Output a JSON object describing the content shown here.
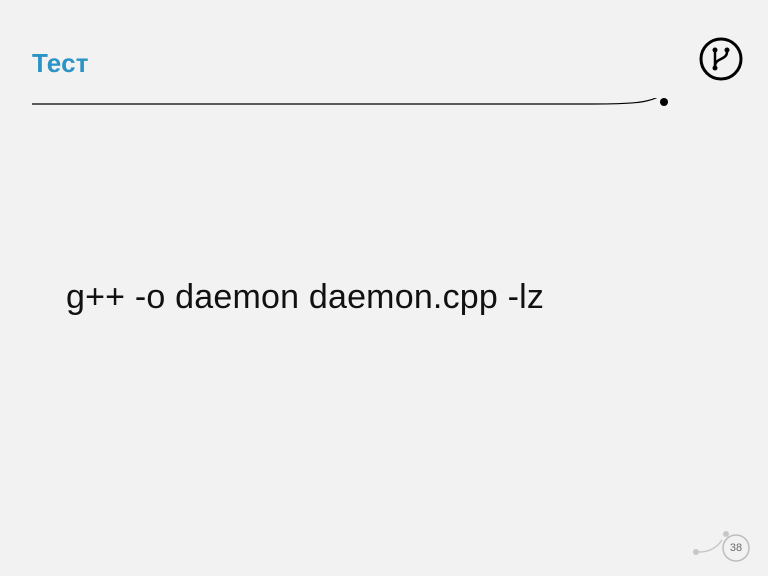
{
  "title": "Тест",
  "command": "g++ -o daemon daemon.cpp -lz",
  "page_number": "38",
  "decor": {
    "accent_color": "#2a94c6",
    "badge_icon": "git-branch-icon"
  }
}
